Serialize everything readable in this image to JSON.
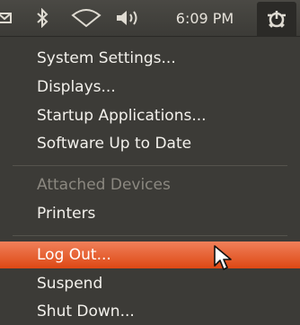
{
  "panel": {
    "icons": [
      "email-icon",
      "bluetooth-icon",
      "network-icon",
      "volume-icon",
      "power-icon"
    ],
    "clock": "6:09 PM"
  },
  "menu": {
    "system_settings": "System Settings...",
    "displays": "Displays...",
    "startup_apps": "Startup Applications...",
    "software_up_to_date": "Software Up to Date",
    "attached_devices_header": "Attached Devices",
    "printers": "Printers",
    "log_out": "Log Out...",
    "suspend": "Suspend",
    "shut_down": "Shut Down..."
  },
  "colors": {
    "accent": "#dd4814",
    "panel_bg": "#3c3b37",
    "text": "#f3f1ec",
    "disabled_text": "#8b8880"
  }
}
